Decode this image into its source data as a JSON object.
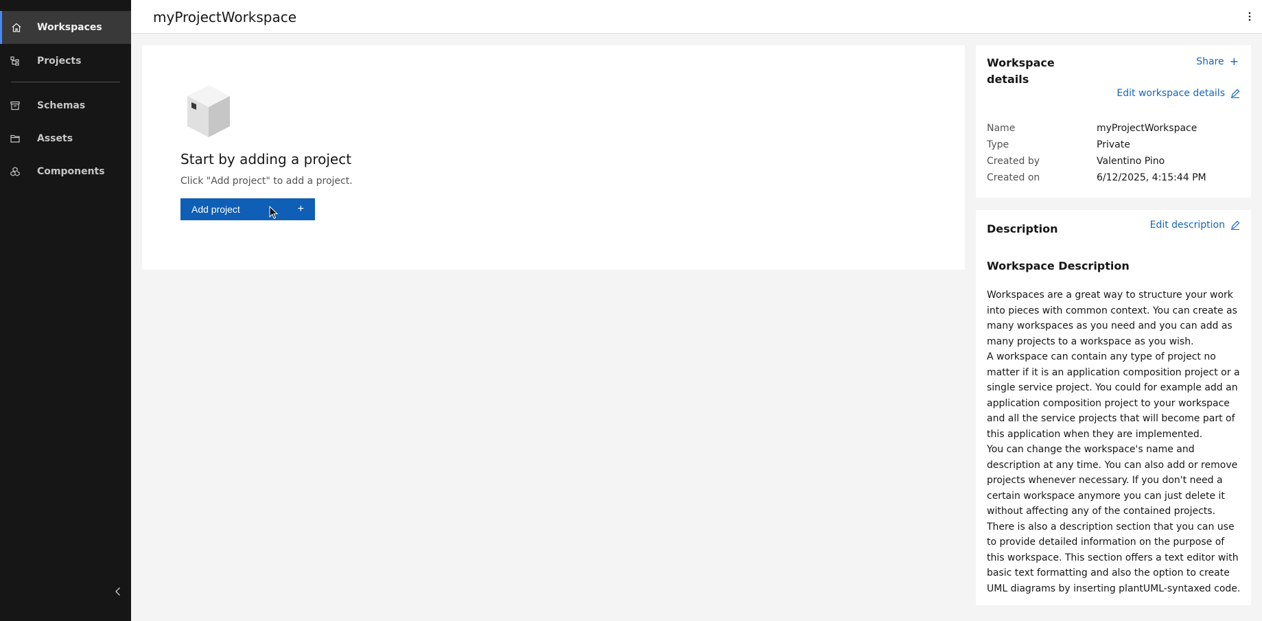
{
  "sidebar": {
    "items": [
      {
        "label": "Workspaces",
        "icon": "home-icon",
        "active": true
      },
      {
        "label": "Projects",
        "icon": "tree-icon"
      },
      {
        "label": "Schemas",
        "icon": "archive-icon"
      },
      {
        "label": "Assets",
        "icon": "folder-icon"
      },
      {
        "label": "Components",
        "icon": "cubes-icon"
      }
    ]
  },
  "header": {
    "title": "myProjectWorkspace"
  },
  "empty_state": {
    "title": "Start by adding a project",
    "subtitle": "Click \"Add project\" to add a project.",
    "button_label": "Add project",
    "button_icon": "+"
  },
  "details": {
    "title": "Workspace details",
    "share_label": "Share",
    "share_icon": "+",
    "edit_label": "Edit workspace details",
    "fields": [
      {
        "label": "Name",
        "value": "myProjectWorkspace"
      },
      {
        "label": "Type",
        "value": "Private"
      },
      {
        "label": "Created by",
        "value": "Valentino Pino"
      },
      {
        "label": "Created on",
        "value": "6/12/2025, 4:15:44 PM"
      }
    ]
  },
  "description": {
    "title": "Description",
    "edit_label": "Edit description",
    "heading": "Workspace Description",
    "paragraphs": [
      "Workspaces are a great way to structure your work into pieces with common context. You can create as many workspaces as you need and you can add as many projects to a workspace as you wish.",
      "A workspace can contain any type of project no matter if it is an application composition project or a single service project. You could for example add an application composition project to your workspace and all the service projects that will become part of this application when they are implemented.",
      "You can change the workspace's name and description at any time. You can also add or remove projects whenever necessary. If you don't need a certain workspace anymore you can just delete it without affecting any of the contained projects.",
      "There is also a description section that you can use to provide detailed information on the purpose of this workspace. This section offers a text editor with basic text formatting and also the option to create UML diagrams by inserting plantUML-syntaxed code."
    ]
  },
  "colors": {
    "sidebar_bg": "#161616",
    "active_accent": "#4589ff",
    "primary_button": "#0e5fb5",
    "link": "#1565c0"
  }
}
